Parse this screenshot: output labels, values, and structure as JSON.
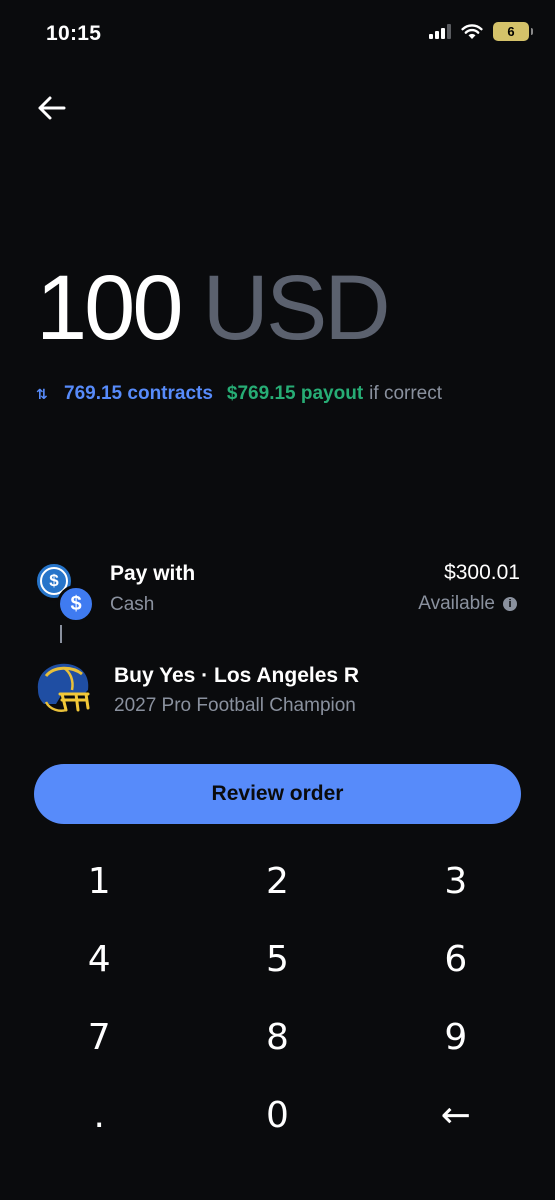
{
  "status_bar": {
    "time": "10:15",
    "battery": "6"
  },
  "amount": {
    "value": "100",
    "currency": "USD"
  },
  "conversion": {
    "contracts": "769.15 contracts",
    "payout": "$769.15 payout",
    "suffix": "if correct"
  },
  "pay_with": {
    "label": "Pay with",
    "method": "Cash",
    "balance": "$300.01",
    "balance_label": "Available"
  },
  "order": {
    "title": "Buy Yes · Los Angeles R",
    "subtitle": "2027 Pro Football Champion"
  },
  "review_button": "Review order",
  "keypad": [
    "1",
    "2",
    "3",
    "4",
    "5",
    "6",
    "7",
    "8",
    "9",
    ".",
    "0",
    "←"
  ],
  "colors": {
    "accent_blue": "#578bfa",
    "payout_green": "#27ad75",
    "muted": "#8a919e",
    "background": "#0a0b0d"
  }
}
